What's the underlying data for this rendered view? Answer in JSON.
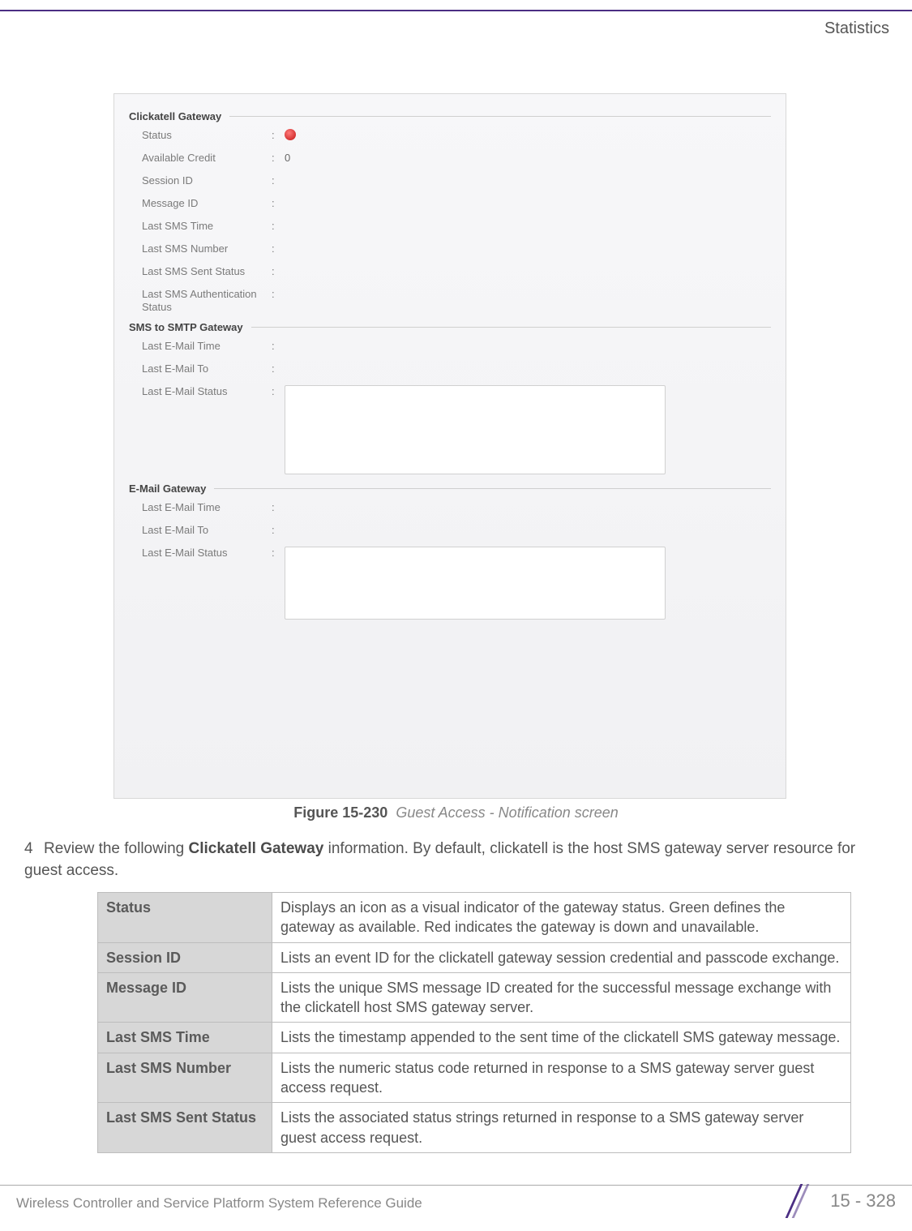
{
  "header": {
    "section": "Statistics"
  },
  "figure": {
    "label": "Figure 15-230",
    "caption": "Guest Access - Notification screen"
  },
  "screenshot": {
    "groups": [
      {
        "title": "Clickatell Gateway",
        "fields": [
          {
            "label": "Status",
            "value": "",
            "status_dot": true
          },
          {
            "label": "Available Credit",
            "value": "0"
          },
          {
            "label": "Session ID",
            "value": ""
          },
          {
            "label": "Message ID",
            "value": ""
          },
          {
            "label": "Last SMS Time",
            "value": ""
          },
          {
            "label": "Last SMS Number",
            "value": ""
          },
          {
            "label": "Last SMS Sent Status",
            "value": ""
          },
          {
            "label": "Last SMS Authentication Status",
            "value": ""
          }
        ]
      },
      {
        "title": "SMS to SMTP Gateway",
        "fields": [
          {
            "label": "Last E-Mail Time",
            "value": ""
          },
          {
            "label": "Last E-Mail To",
            "value": ""
          },
          {
            "label": "Last E-Mail Status",
            "value": "",
            "textarea": true
          }
        ]
      },
      {
        "title": "E-Mail Gateway",
        "fields": [
          {
            "label": "Last E-Mail Time",
            "value": ""
          },
          {
            "label": "Last E-Mail To",
            "value": ""
          },
          {
            "label": "Last E-Mail Status",
            "value": "",
            "textarea": true,
            "small": true
          }
        ]
      }
    ]
  },
  "step": {
    "number": "4",
    "text_a": "Review the following ",
    "bold": "Clickatell Gateway",
    "text_b": " information. By default, clickatell is the host SMS gateway server resource for guest access."
  },
  "definitions": [
    {
      "term": "Status",
      "desc": "Displays an icon as a visual indicator of the gateway status. Green defines the gateway as available. Red indicates the gateway is down and unavailable."
    },
    {
      "term": "Session ID",
      "desc": "Lists an event ID for the clickatell gateway session credential and passcode exchange."
    },
    {
      "term": "Message ID",
      "desc": "Lists the unique SMS message ID created for the successful message exchange with the clickatell host SMS gateway server."
    },
    {
      "term": "Last SMS Time",
      "desc": "Lists the timestamp appended to the sent time of the clickatell SMS gateway message."
    },
    {
      "term": "Last SMS Number",
      "desc": "Lists the numeric status code returned in response to a SMS gateway server guest access request."
    },
    {
      "term": "Last SMS Sent Status",
      "desc": "Lists the associated status strings returned in response to a SMS gateway server guest access request."
    }
  ],
  "footer": {
    "left": "Wireless Controller and Service Platform System Reference Guide",
    "right": "15 - 328"
  }
}
